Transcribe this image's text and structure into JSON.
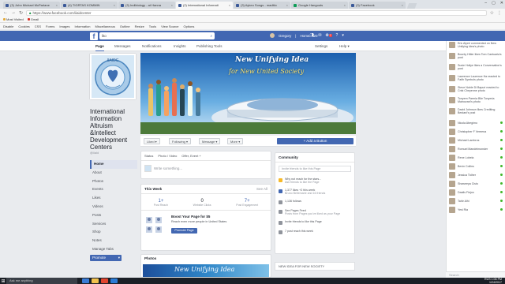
{
  "browser": {
    "tabs": [
      {
        "label": "(3) John Michael McParlane",
        "active": false
      },
      {
        "label": "(4) TIGRTAS KOMMIN",
        "active": false
      },
      {
        "label": "(3) Indibiology - at Hanna",
        "active": false
      },
      {
        "label": "(2) International Informati",
        "active": true
      },
      {
        "label": "(3) Aykeo Songs - maditio",
        "active": false
      },
      {
        "label": "Google Hangouts",
        "active": false
      },
      {
        "label": "(3) Facebook",
        "active": false
      }
    ],
    "url": "https://www.facebook.com/iiaidcenter",
    "window_controls": [
      "–",
      "▢",
      "✕"
    ],
    "bookmarks": [
      "Most Visited",
      "Gmail"
    ],
    "bookmarks2": [
      "Disable",
      "Cookies",
      "CSS",
      "Forms",
      "Images",
      "Information",
      "Miscellaneous",
      "Outline",
      "Resize",
      "Tools",
      "View Source",
      "Options"
    ]
  },
  "facebook": {
    "logo": "f",
    "search_value": "lito",
    "user_name": "Gregory",
    "home_label": "Home",
    "home_count": "20",
    "notif_badge": "7",
    "nav": [
      "Page",
      "Messages",
      "Notifications",
      "Insights",
      "Publishing Tools"
    ],
    "nav_right": [
      "Settings",
      "Help ▾"
    ]
  },
  "page": {
    "name": "International Information Altruism &Intellect Development Centers",
    "handle": "@iiaid",
    "left_menu": [
      "Home",
      "About",
      "Photos",
      "Events",
      "Likes",
      "Videos",
      "Posts",
      "Services",
      "Shop",
      "Notes",
      "Manage Tabs"
    ],
    "promote": "Promote",
    "cover_title1": "New Unifying Idea",
    "cover_title2": "for New United Society",
    "actions": [
      "Liked ▾",
      "Following ▾",
      "Message ▾",
      "More ▾"
    ],
    "add_button": "+ Add a Button"
  },
  "composer": {
    "tabs": [
      "Status",
      "Photo / Video",
      "Offer, Event +"
    ],
    "placeholder": "Write something..."
  },
  "this_week": {
    "title": "This Week",
    "see_all": "See All",
    "stats": [
      {
        "value": "1+",
        "label": "Post Reach"
      },
      {
        "value": "0",
        "label": "Website Clicks"
      },
      {
        "value": "7+",
        "label": "Post Engagement"
      }
    ],
    "boost_title": "Boost Your Page for $5",
    "boost_desc": "Reach even more people in United States",
    "boost_button": "Promote Page"
  },
  "photos": {
    "title": "Photos",
    "preview_text": "New Unifying Idea"
  },
  "community": {
    "title": "Community",
    "invite_placeholder": "Invite friends to like this Page",
    "items": [
      {
        "line1": "Why not reach for the stars...",
        "line2": "Ask friends to like the Page"
      },
      {
        "line1": "1,377 likes +2 this week",
        "line2": "Bruno Bellemarie and 16 friends"
      },
      {
        "line1": "1,136 follows",
        "line2": ""
      },
      {
        "line1": "See Pages Feed",
        "line2": "Posts from Pages you've liked as your Page"
      },
      {
        "line1": "Invite friends to like this Page",
        "line2": ""
      },
      {
        "line1": "7 post reach this week",
        "line2": ""
      }
    ],
    "new_idea": "NEW IDEA FOR NEW SOCIETY"
  },
  "chat": {
    "feed": [
      "Eric Alyeri commented on New Unifying Idea's photo",
      "Bounty Hitler likes Tom Cantuaria's post",
      "Susie Hollye likes a Conversation's post",
      "Lawrence Laurence Ha reacted to Faith Symbols photo",
      "Steve Noble Di Bapuri reacted to Crist Cheyenne photo",
      "Tonyem Parmia Bile Tonyeria Mainovani's photo",
      "David Johnson likes Crediting Bestani's post"
    ],
    "contacts": [
      "Nicola Abegimo",
      "Christopher F Vereena",
      "Michael Lambros",
      "Romuel Mandelmonster",
      "Rene Lobela",
      "Bevin Collins",
      "Jessica Tidher",
      "Shaweeya Cisto",
      "Daalis Fiejoo",
      "Tahir Alhi",
      "Yesi Ria"
    ],
    "search": "Search"
  },
  "taskbar": {
    "search": "Ask me anything",
    "time": "1:06 PM",
    "date": "1/24/2017",
    "lang": "RUS"
  }
}
